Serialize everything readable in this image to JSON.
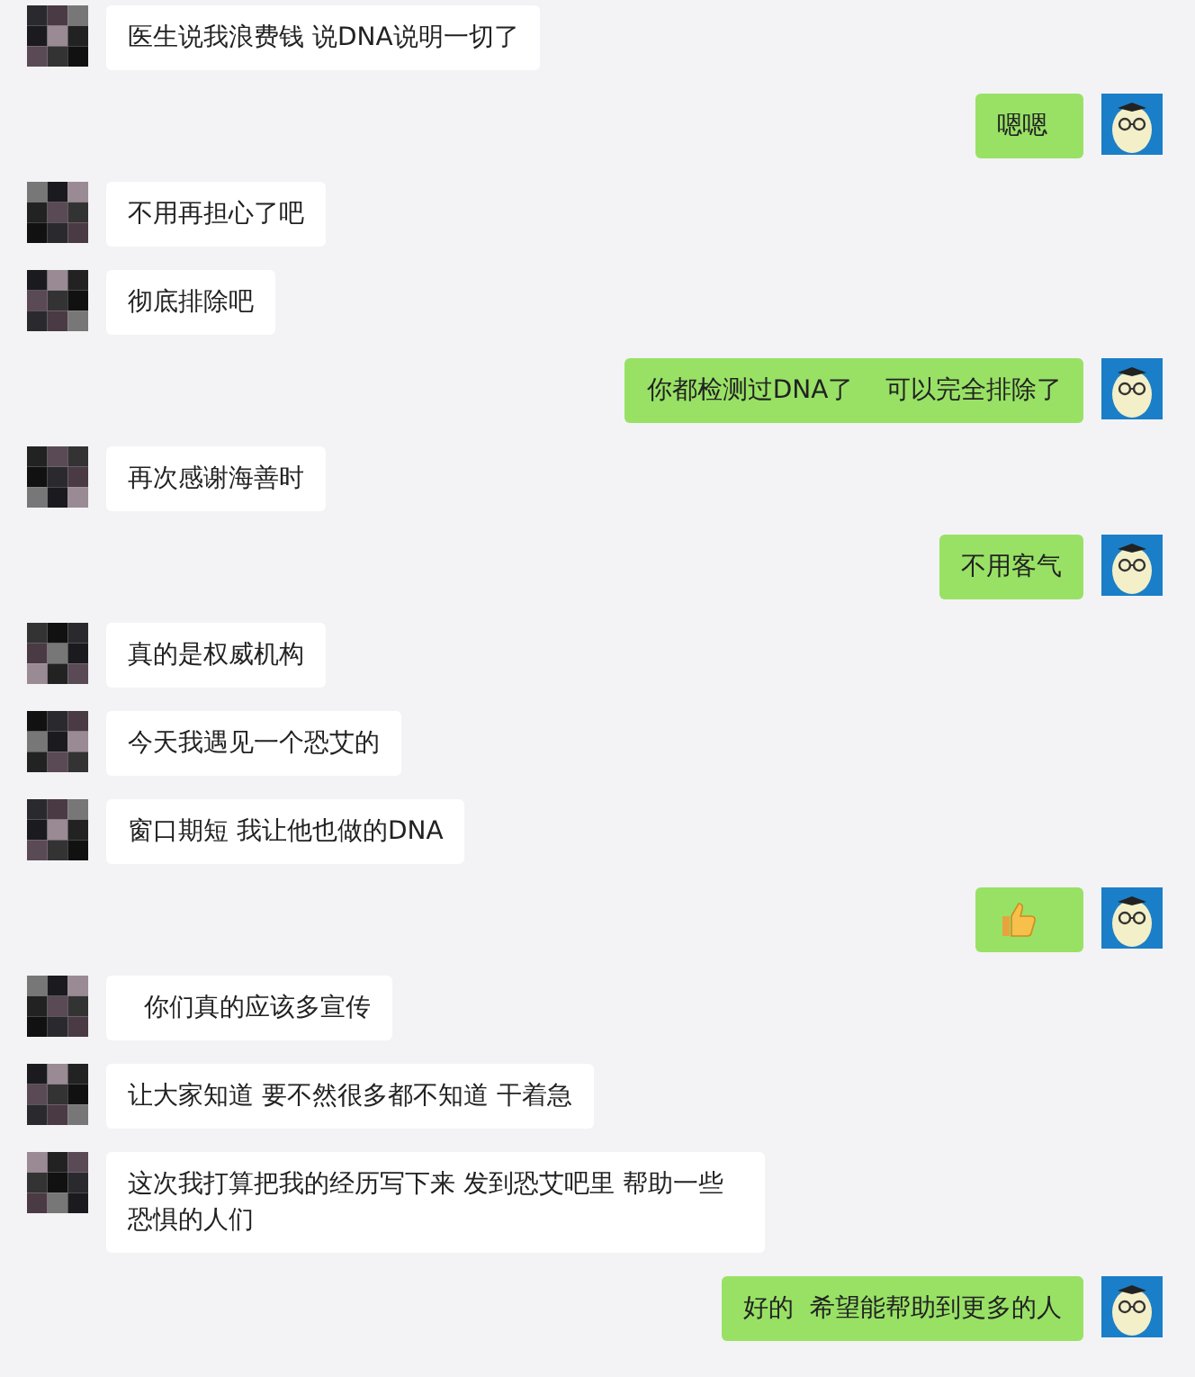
{
  "messages": [
    {
      "outgoing": false,
      "kind": "text",
      "text": "医生说我浪费钱 说DNA说明一切了"
    },
    {
      "outgoing": true,
      "kind": "text",
      "text": "嗯嗯"
    },
    {
      "outgoing": false,
      "kind": "text",
      "text": "不用再担心了吧"
    },
    {
      "outgoing": false,
      "kind": "text",
      "text": "彻底排除吧"
    },
    {
      "outgoing": true,
      "kind": "text",
      "text": "你都检测过DNA了    可以完全排除了"
    },
    {
      "outgoing": false,
      "kind": "text",
      "text": "再次感谢海善时"
    },
    {
      "outgoing": true,
      "kind": "text",
      "text": "不用客气"
    },
    {
      "outgoing": false,
      "kind": "text",
      "text": "真的是权威机构"
    },
    {
      "outgoing": false,
      "kind": "text",
      "text": "今天我遇见一个恐艾的"
    },
    {
      "outgoing": false,
      "kind": "text",
      "text": "窗口期短 我让他也做的DNA"
    },
    {
      "outgoing": true,
      "kind": "sticker"
    },
    {
      "outgoing": false,
      "kind": "text",
      "text": "  你们真的应该多宣传"
    },
    {
      "outgoing": false,
      "kind": "text",
      "text": "让大家知道 要不然很多都不知道 干着急"
    },
    {
      "outgoing": false,
      "kind": "text",
      "text": "这次我打算把我的经历写下来 发到恐艾吧里 帮助一些恐惧的人们"
    },
    {
      "outgoing": true,
      "kind": "text",
      "text": "好的  希望能帮助到更多的人"
    }
  ]
}
